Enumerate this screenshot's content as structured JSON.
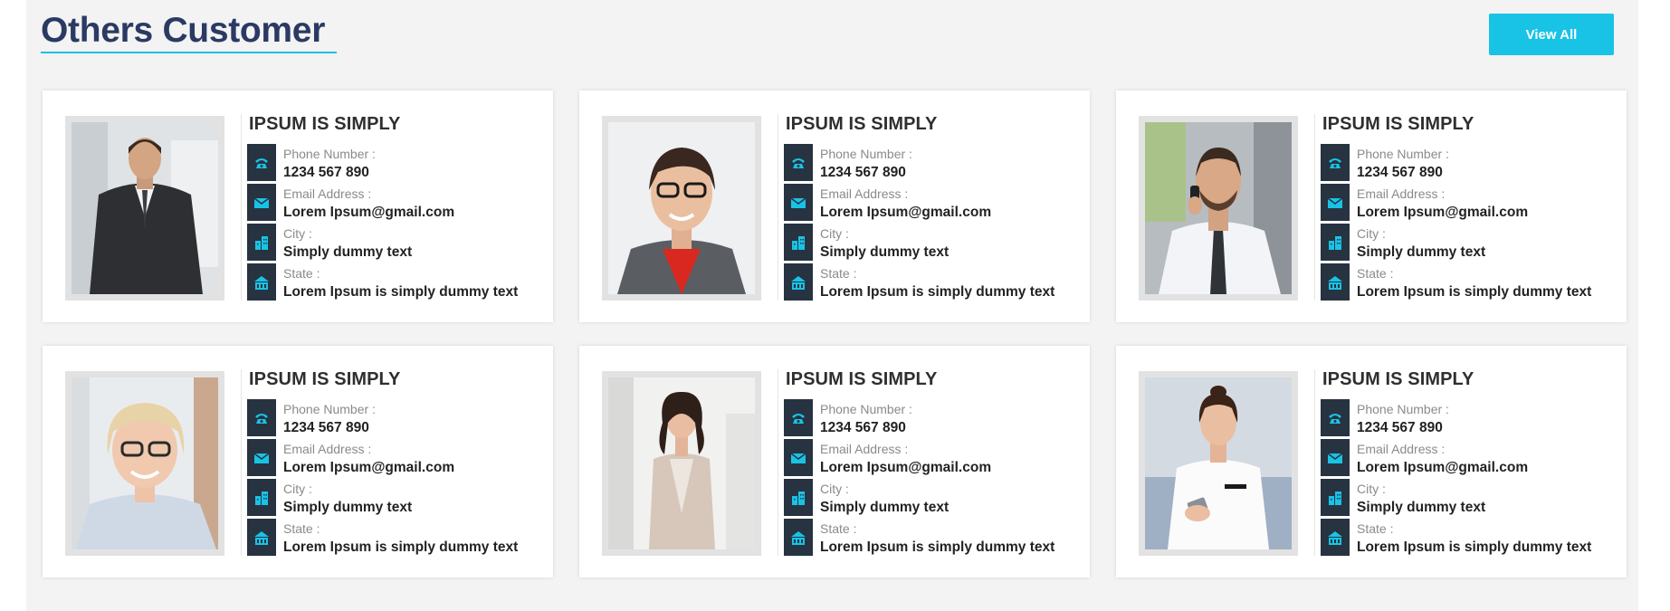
{
  "header": {
    "title": "Others Customer",
    "view_all_label": "View All"
  },
  "colors": {
    "accent": "#18c3e6",
    "title": "#2b3a63",
    "icon_bg": "#273340",
    "panel_bg": "#f3f3f3"
  },
  "labels": {
    "phone": "Phone Number :",
    "email": "Email Address :",
    "city": "City :",
    "state": "State :"
  },
  "icons": {
    "phone": "phone-icon",
    "email": "envelope-icon",
    "city": "city-building-icon",
    "state": "state-building-icon"
  },
  "customers": [
    {
      "name": "IPSUM IS SIMPLY",
      "phone": "1234 567 890",
      "email": "Lorem Ipsum@gmail.com",
      "city": "Simply dummy text",
      "state": "Lorem Ipsum is simply dummy text",
      "photo": "man-in-suit-portrait"
    },
    {
      "name": "IPSUM IS SIMPLY",
      "phone": "1234 567 890",
      "email": "Lorem Ipsum@gmail.com",
      "city": "Simply dummy text",
      "state": "Lorem Ipsum is simply dummy text",
      "photo": "woman-with-glasses-portrait"
    },
    {
      "name": "IPSUM IS SIMPLY",
      "phone": "1234 567 890",
      "email": "Lorem Ipsum@gmail.com",
      "city": "Simply dummy text",
      "state": "Lorem Ipsum is simply dummy text",
      "photo": "man-on-phone-in-car-portrait"
    },
    {
      "name": "IPSUM IS SIMPLY",
      "phone": "1234 567 890",
      "email": "Lorem Ipsum@gmail.com",
      "city": "Simply dummy text",
      "state": "Lorem Ipsum is simply dummy text",
      "photo": "older-woman-with-glasses-portrait"
    },
    {
      "name": "IPSUM IS SIMPLY",
      "phone": "1234 567 890",
      "email": "Lorem Ipsum@gmail.com",
      "city": "Simply dummy text",
      "state": "Lorem Ipsum is simply dummy text",
      "photo": "woman-in-beige-blazer-portrait"
    },
    {
      "name": "IPSUM IS SIMPLY",
      "phone": "1234 567 890",
      "email": "Lorem Ipsum@gmail.com",
      "city": "Simply dummy text",
      "state": "Lorem Ipsum is simply dummy text",
      "photo": "woman-with-smartphone-portrait"
    }
  ]
}
